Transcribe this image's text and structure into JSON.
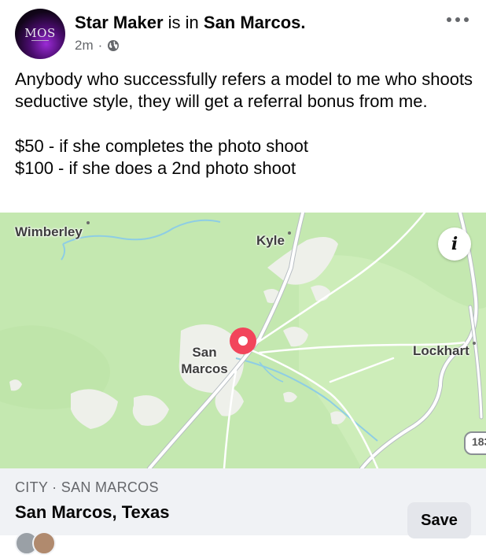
{
  "post": {
    "author": "Star Maker",
    "checkin_verb": "is in",
    "location": "San Marcos.",
    "time": "2m",
    "privacy_icon": "globe-icon",
    "avatar_text": "MOS",
    "body": [
      "Anybody who successfully refers a model to me who shoots seductive style, they will get a referral bonus from me.",
      "$50 - if she completes the photo shoot",
      "$100 - if she does a 2nd photo shoot"
    ]
  },
  "map": {
    "labels": {
      "wimberley": "Wimberley",
      "kyle": "Kyle",
      "san": "San",
      "marcos": "Marcos",
      "lockhart": "Lockhart",
      "highway": "183"
    },
    "info_icon": "i",
    "colors": {
      "land": "#c4e8b0",
      "urban": "#eef0ea",
      "road": "#ffffff",
      "water": "#8ecde4",
      "pin": "#f2455b"
    }
  },
  "place": {
    "category": "CITY · SAN MARCOS",
    "name": "San Marcos, Texas",
    "save_label": "Save"
  }
}
